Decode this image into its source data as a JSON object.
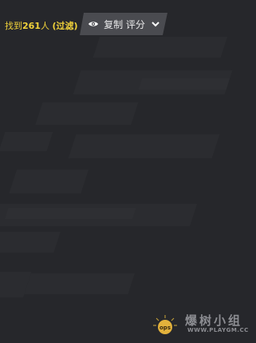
{
  "toolbar": {
    "found_prefix": "找到",
    "found_count": "261",
    "found_suffix": "人",
    "filter_label": "(过滤)",
    "view_button_label": "复制 评分"
  },
  "icons": {
    "view_icon": "eye-icon",
    "dropdown_icon": "chevron-down-icon",
    "watermark_logo": "oops-logo"
  },
  "watermark": {
    "title": "爆树小组",
    "url": "WWW.PLAYGM.CC",
    "logo_text": "ops"
  },
  "colors": {
    "background": "#26272b",
    "stripe": "#2c2d31",
    "highlight_text": "#f0d23a",
    "button_bg": "#4a4b50",
    "button_text": "#e9e9ea",
    "watermark": "#8c8d92"
  }
}
